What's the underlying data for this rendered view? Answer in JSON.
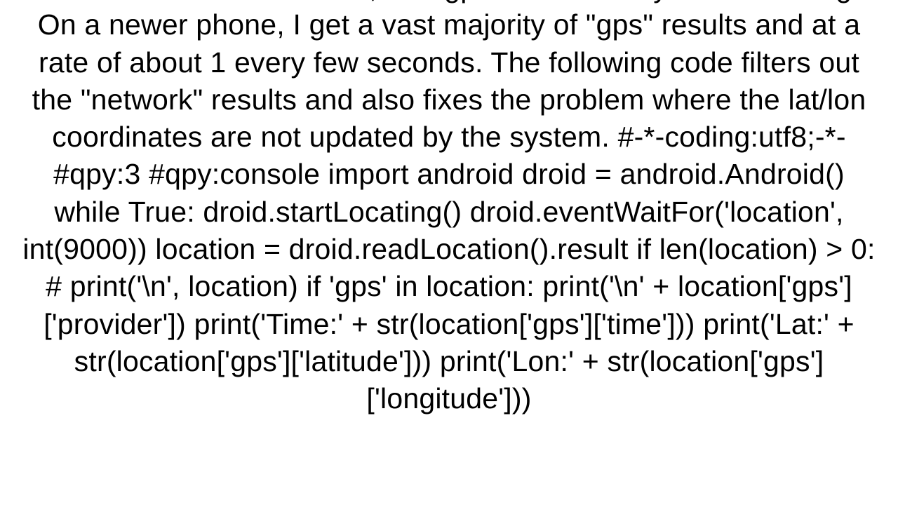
{
  "body_text": "of the results are \"network\", but \"gps\" occasionally comes through. On a newer phone, I get a vast majority of \"gps\" results and at a rate of about 1 every few seconds.  The following code filters out the \"network\" results and also fixes the problem where the lat/lon coordinates are not updated by the system.    #-*-coding:utf8;-*-    #qpy:3    #qpy:console     import android    droid = android.Android()    while True:         droid.startLocating()         droid.eventWaitFor('location', int(9000))         location = droid.readLocation().result         if len(location) > 0:             # print('\\n', location)             if 'gps' in location:                 print('\\n' + location['gps']['provider'])                 print('Time:' + str(location['gps']['time']))                 print('Lat:' + str(location['gps']['latitude']))                 print('Lon:' + str(location['gps']['longitude']))"
}
